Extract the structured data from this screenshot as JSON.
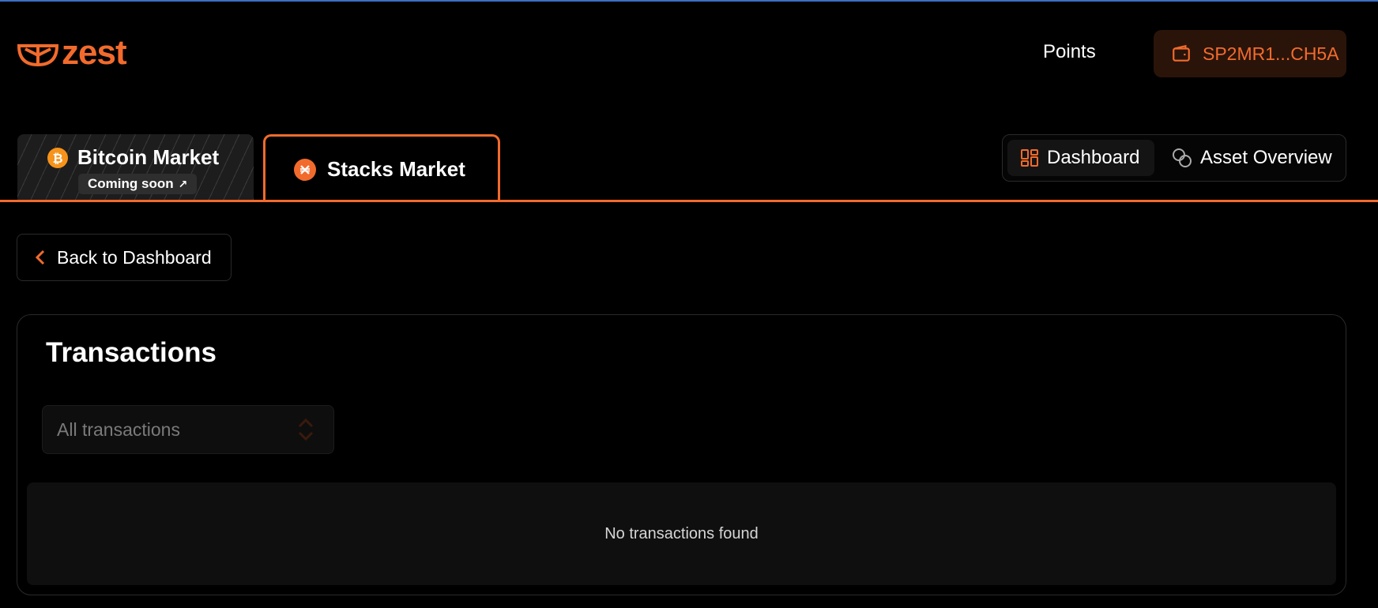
{
  "brand": {
    "name": "zest",
    "accent": "#f26b2c"
  },
  "header": {
    "points_label": "Points",
    "wallet_address": "SP2MR1...CH5A"
  },
  "markets": {
    "bitcoin": {
      "label": "Bitcoin Market",
      "badge": "Coming soon",
      "icon": "bitcoin-icon"
    },
    "stacks": {
      "label": "Stacks Market",
      "icon": "stacks-icon",
      "active": true
    }
  },
  "views": {
    "dashboard": "Dashboard",
    "asset_overview": "Asset Overview",
    "selected": "Dashboard"
  },
  "back_button": {
    "label": "Back to Dashboard"
  },
  "transactions": {
    "title": "Transactions",
    "filter": {
      "selected": "All transactions"
    },
    "empty_message": "No transactions found"
  }
}
